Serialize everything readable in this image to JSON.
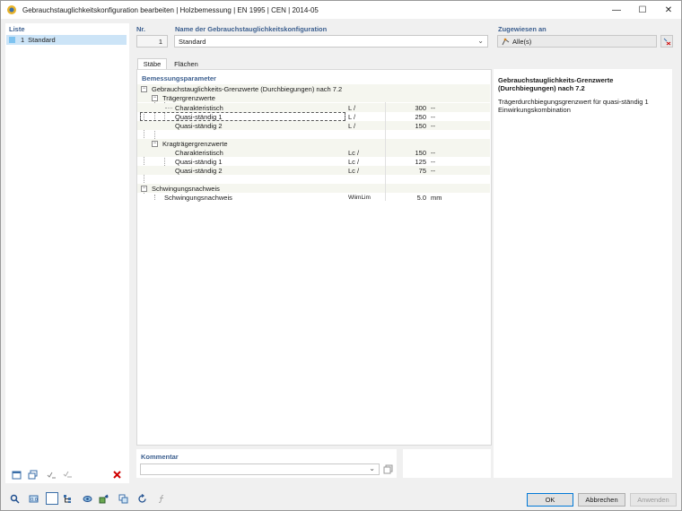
{
  "window": {
    "title": "Gebrauchstauglichkeitskonfiguration bearbeiten | Holzbemessung | EN 1995 | CEN | 2014-05",
    "minimize": "—",
    "maximize": "☐",
    "close": "✕"
  },
  "list": {
    "header": "Liste",
    "items": [
      {
        "num": "1",
        "name": "Standard"
      }
    ]
  },
  "config": {
    "nr_label": "Nr.",
    "nr_value": "1",
    "name_label": "Name der Gebrauchstauglichkeitskonfiguration",
    "name_value": "Standard",
    "assigned_label": "Zugewiesen an",
    "assigned_value": "Alle(s)"
  },
  "tabs": [
    "Stäbe",
    "Flächen"
  ],
  "params": {
    "header": "Bemessungsparameter",
    "group1": "Gebrauchstauglichkeits-Grenzwerte (Durchbiegungen) nach 7.2",
    "sub1": "Trägergrenzwerte",
    "sub1_rows": [
      {
        "label": "Charakteristisch",
        "sym": "L /",
        "value": "300",
        "unit": "--"
      },
      {
        "label": "Quasi-ständig 1",
        "sym": "L /",
        "value": "250",
        "unit": "--"
      },
      {
        "label": "Quasi-ständig 2",
        "sym": "L /",
        "value": "150",
        "unit": "--"
      }
    ],
    "sub2": "Kragträgergrenzwerte",
    "sub2_rows": [
      {
        "label": "Charakteristisch",
        "sym": "Lc /",
        "value": "150",
        "unit": "--"
      },
      {
        "label": "Quasi-ständig 1",
        "sym": "Lc /",
        "value": "125",
        "unit": "--"
      },
      {
        "label": "Quasi-ständig 2",
        "sym": "Lc /",
        "value": "75",
        "unit": "--"
      }
    ],
    "group2": "Schwingungsnachweis",
    "group2_row": {
      "label": "Schwingungsnachweis",
      "sym": "WlimLim",
      "value": "5.0",
      "unit": "mm"
    }
  },
  "info": {
    "title": "Gebrauchstauglichkeits-Grenzwerte (Durchbiegungen) nach 7.2",
    "description": "Trägerdurchbiegungsgrenzwert für quasi-ständig 1 Einwirkungskombination"
  },
  "comment": {
    "label": "Kommentar",
    "value": ""
  },
  "buttons": {
    "ok": "OK",
    "cancel": "Abbrechen",
    "apply": "Anwenden"
  },
  "colors": {
    "accent": "#3c5f8f",
    "selection": "#cce4f7",
    "delete": "#d00000",
    "default_button_border": "#0078d7"
  }
}
